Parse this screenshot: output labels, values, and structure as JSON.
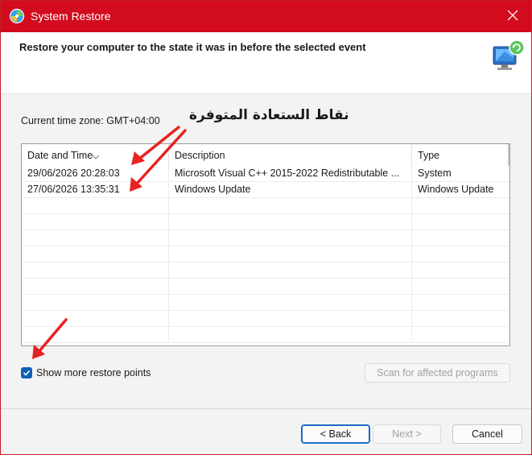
{
  "window": {
    "title": "System Restore",
    "accent_color": "#d30b1e"
  },
  "header": {
    "instruction": "Restore your computer to the state it was in before the selected event"
  },
  "timezone_label": "Current time zone: GMT+04:00",
  "annotation_text": "نقاط الستعادة المتوفرة",
  "table": {
    "columns": [
      "Date and Time",
      "Description",
      "Type"
    ],
    "rows": [
      {
        "date": "29/06/2026 20:28:03",
        "description": "Microsoft Visual C++ 2015-2022 Redistributable ...",
        "type": "System"
      },
      {
        "date": "27/06/2026 13:35:31",
        "description": "Windows Update",
        "type": "Windows Update"
      }
    ]
  },
  "show_more": {
    "label": "Show more restore points",
    "checked": true
  },
  "buttons": {
    "scan": "Scan for affected programs",
    "back": "< Back",
    "next": "Next >",
    "cancel": "Cancel"
  },
  "icons": {
    "app": "system-restore-icon",
    "header": "restore-monitor-icon",
    "close": "close-icon"
  }
}
